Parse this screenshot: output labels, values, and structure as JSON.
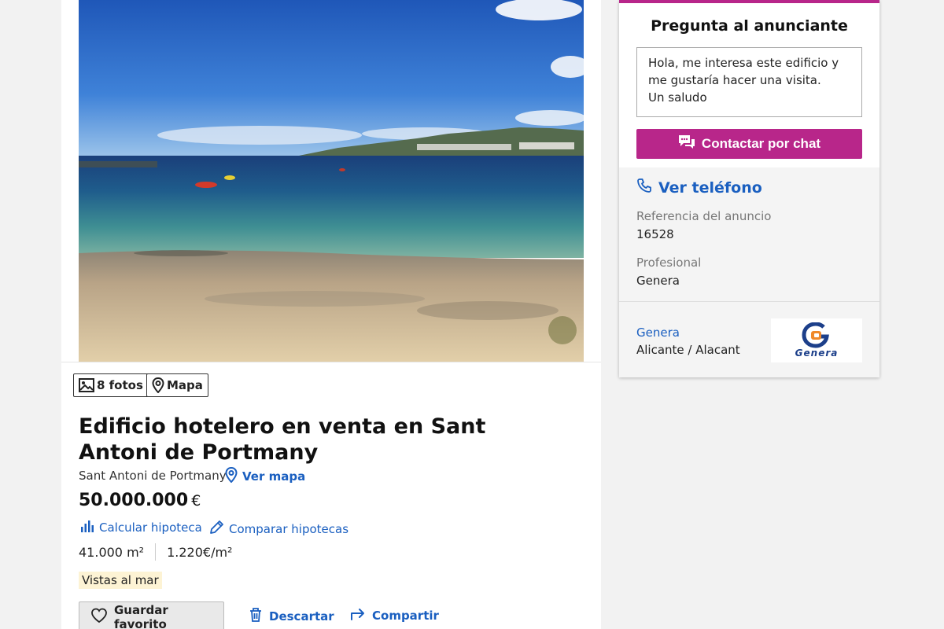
{
  "gallery": {
    "photos_label": "8 fotos",
    "map_label": "Mapa"
  },
  "listing": {
    "title": "Edificio hotelero en venta en Sant Antoni de Portmany",
    "location": "Sant Antoni de Portmany",
    "view_map_label": "Ver mapa",
    "price": "50.000.000",
    "currency": "€",
    "calc_mortgage_label": "Calcular hipoteca",
    "compare_mortgage_label": "Comparar hipotecas",
    "area": "41.000 m²",
    "price_per_m2": "1.220€/m²",
    "tag": "Vistas al mar"
  },
  "actions": {
    "favorite_label": "Guardar favorito",
    "discard_label": "Descartar",
    "share_label": "Compartir"
  },
  "contact": {
    "heading": "Pregunta al anunciante",
    "message": "Hola, me interesa este edificio y me gustaría hacer una visita.\nUn saludo",
    "chat_button_label": "Contactar por chat",
    "phone_label": "Ver teléfono",
    "reference_label": "Referencia del anuncio",
    "reference_value": "16528",
    "professional_label": "Profesional",
    "professional_value": "Genera",
    "agency_name": "Genera",
    "agency_location": "Alicante / Alacant",
    "logo_text": "Genera"
  },
  "colors": {
    "accent": "#b8268a",
    "link": "#1a5fc0",
    "tag_background": "#fdf3d4"
  }
}
